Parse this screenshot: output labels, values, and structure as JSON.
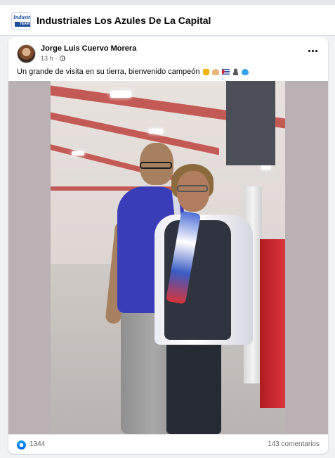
{
  "group": {
    "name": "Industriales Los Azules De La Capital",
    "logo_text": "Industr",
    "logo_bar_text": "TEAM"
  },
  "post": {
    "author": "Jorge Luis Cuervo Morera",
    "time": "13 h",
    "separator": "·",
    "caption": "Un grande de visita en su tierra, bienvenido campeón",
    "caption_emojis": [
      "thumbs-up-icon",
      "folded-hands-icon",
      "cuba-flag-icon",
      "person-silhouette-icon",
      "blue-heart-icon"
    ],
    "more_icon": "more-horizontal-icon"
  },
  "reactions": {
    "count": "1344",
    "comments": "143 comentarios",
    "icon": "like-reaction-icon"
  },
  "colors": {
    "background": "#f0f2f5",
    "card": "#ffffff",
    "text_primary": "#050505",
    "text_secondary": "#65676b",
    "like_blue": "#0866ff"
  }
}
